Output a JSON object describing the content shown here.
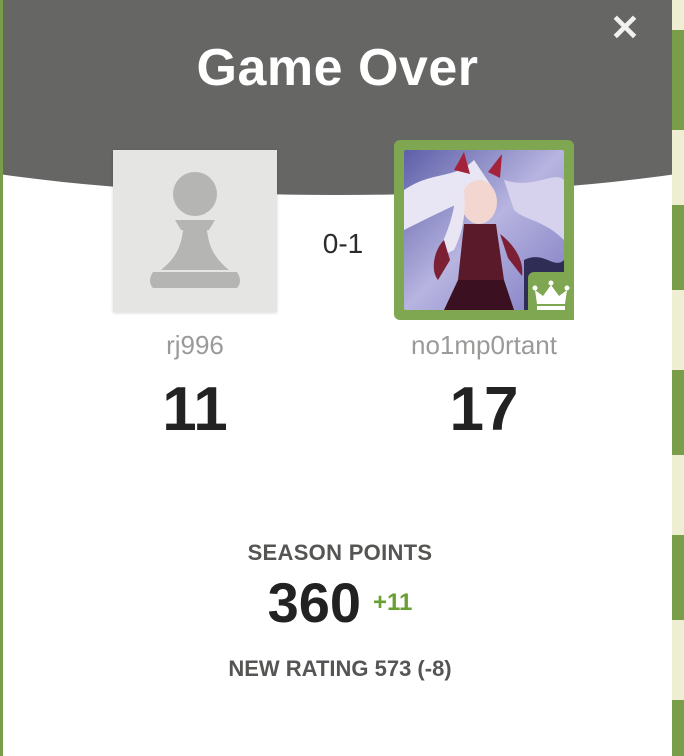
{
  "modal": {
    "title": "Game Over",
    "close_icon": "close-icon"
  },
  "players": {
    "left": {
      "username": "rj996",
      "points": "11",
      "avatar": "pawn-icon"
    },
    "right": {
      "username": "no1mp0rtant",
      "points": "17",
      "avatar": "anime-character-avatar",
      "badge": "crown-icon"
    }
  },
  "result": "0-1",
  "season": {
    "label": "SEASON POINTS",
    "value": "360",
    "delta": "+11"
  },
  "rating": "NEW RATING 573 (-8)",
  "colors": {
    "header": "#666664",
    "winner_border": "#7fa650",
    "delta_green": "#6aa033",
    "board_dark": "#7a9d4a",
    "board_light": "#eeeed2"
  }
}
